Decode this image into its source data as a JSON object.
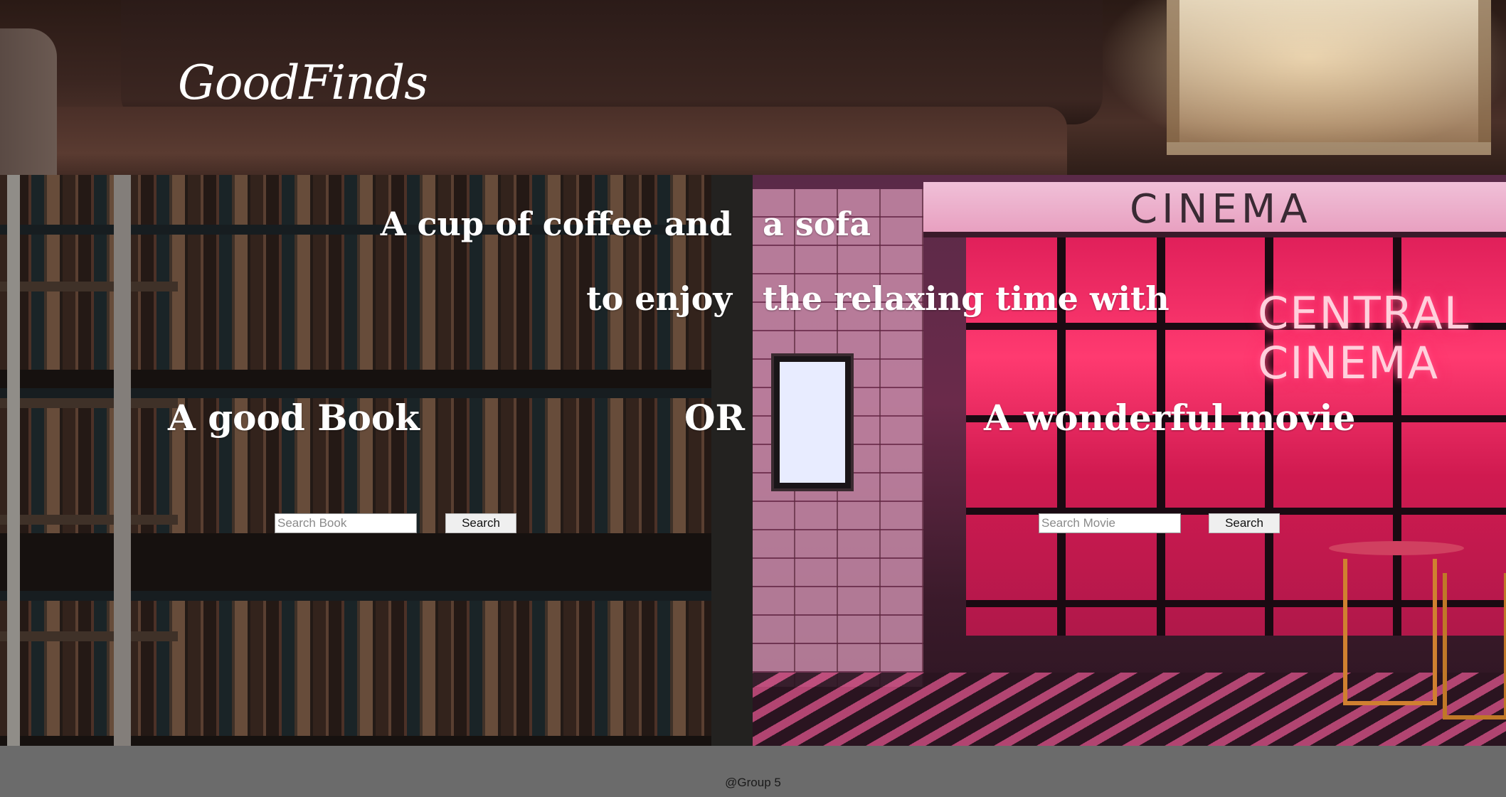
{
  "header": {
    "logo": "GoodFinds"
  },
  "hero": {
    "line1_left": "A cup of coffee and",
    "line1_right": "a sofa",
    "line2_left": "to enjoy",
    "line2_right": "the relaxing time with",
    "book_heading": "A good Book",
    "or_text": "OR",
    "movie_heading": "A wonderful movie",
    "cinema_sign": "CINEMA",
    "neon_sign": "CENTRAL\nCINEMA"
  },
  "book_search": {
    "placeholder": "Search Book",
    "value": "",
    "button_label": "Search"
  },
  "movie_search": {
    "placeholder": "Search Movie",
    "value": "",
    "button_label": "Search"
  },
  "footer": {
    "text": "@Group 5"
  },
  "colors": {
    "footer_bg": "#6b6b6b",
    "text_light": "#ffffff",
    "neon_pink": "#ff3a70"
  }
}
